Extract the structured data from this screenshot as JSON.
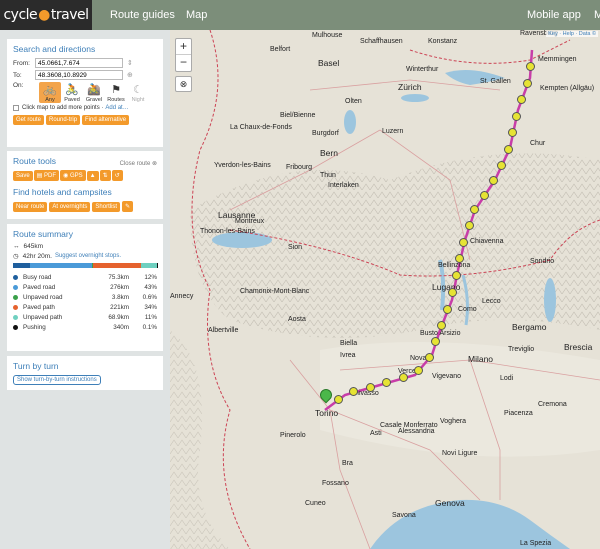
{
  "header": {
    "logo_left": "cycle",
    "logo_right": "travel",
    "nav_guides": "Route guides",
    "nav_map": "Map",
    "nav_mobile": "Mobile app",
    "nav_cut": "M"
  },
  "search": {
    "title": "Search and directions",
    "from_label": "From:",
    "from_value": "45.0661,7.674",
    "to_label": "To:",
    "to_value": "48.3608,10.8929",
    "on_label": "On:",
    "modes": [
      "Any",
      "Paved",
      "Gravel",
      "Routes",
      "Night"
    ],
    "click_hint": "Click map to add more points · ",
    "add_at": "Add at…",
    "get_route": "Get route",
    "round_trip": "Round-trip",
    "find_alt": "Find alternative"
  },
  "tools": {
    "title": "Route tools",
    "close_route": "Close route",
    "save": "Save",
    "pdf": "PDF",
    "gps": "GPS",
    "hotels_title": "Find hotels and campsites",
    "near_route": "Near route",
    "at_overnights": "At overnights",
    "shortlist": "Shortlist"
  },
  "summary": {
    "title": "Route summary",
    "distance": "645km",
    "time": "42hr 20m.",
    "suggest": "Suggest overnight stops.",
    "rows": [
      {
        "name": "Busy road",
        "value": "75.3km",
        "pct": "12%",
        "color": "#1f5f9e"
      },
      {
        "name": "Paved road",
        "value": "276km",
        "pct": "43%",
        "color": "#4a9ad8"
      },
      {
        "name": "Unpaved road",
        "value": "3.8km",
        "pct": "0.6%",
        "color": "#3aa04a"
      },
      {
        "name": "Paved path",
        "value": "221km",
        "pct": "34%",
        "color": "#e5622e"
      },
      {
        "name": "Unpaved path",
        "value": "68.9km",
        "pct": "11%",
        "color": "#6fd0c0"
      },
      {
        "name": "Pushing",
        "value": "340m",
        "pct": "0.1%",
        "color": "#111111"
      }
    ]
  },
  "turn": {
    "title": "Turn by turn",
    "button": "Show turn-by-turn instructions"
  },
  "map": {
    "attribution": "Key · Help · Data ©",
    "labels": [
      "Mulhouse",
      "Schaffhausen",
      "Konstanz",
      "Ravensburg",
      "Belfort",
      "Basel",
      "Winterthur",
      "St. Gallen",
      "Memmingen",
      "Kempten (Allgäu)",
      "Zürich",
      "Biel/Bienne",
      "Olten",
      "La Chaux-de-Fonds",
      "Burgdorf",
      "Luzern",
      "Chur",
      "Bern",
      "Yverdon-les-Bains",
      "Fribourg",
      "Thun",
      "Interlaken",
      "Lausanne",
      "Montreux",
      "Thonon-les-Bains",
      "Bellinzona",
      "Sion",
      "Sondrio",
      "Lugano",
      "Lecco",
      "Bergamo",
      "Brescia",
      "Como",
      "Treviglio",
      "Aosta",
      "Biella",
      "Ivrea",
      "Novara",
      "Milano",
      "Vigevano",
      "Lodi",
      "Cremona",
      "Torino",
      "Casale Monferrato",
      "Alessandria",
      "Piacenza",
      "Pinerolo",
      "Asti",
      "Voghera",
      "Novi Ligure",
      "Bra",
      "Fossano",
      "Cuneo",
      "Savona",
      "Genova",
      "La Spezia",
      "Chamonix-Mont-Blanc",
      "Albertville",
      "Annecy",
      "Chiavenna",
      "Busto Arsizio",
      "Vercelli",
      "Chivasso"
    ],
    "zoom_in": "+",
    "zoom_out": "−"
  }
}
